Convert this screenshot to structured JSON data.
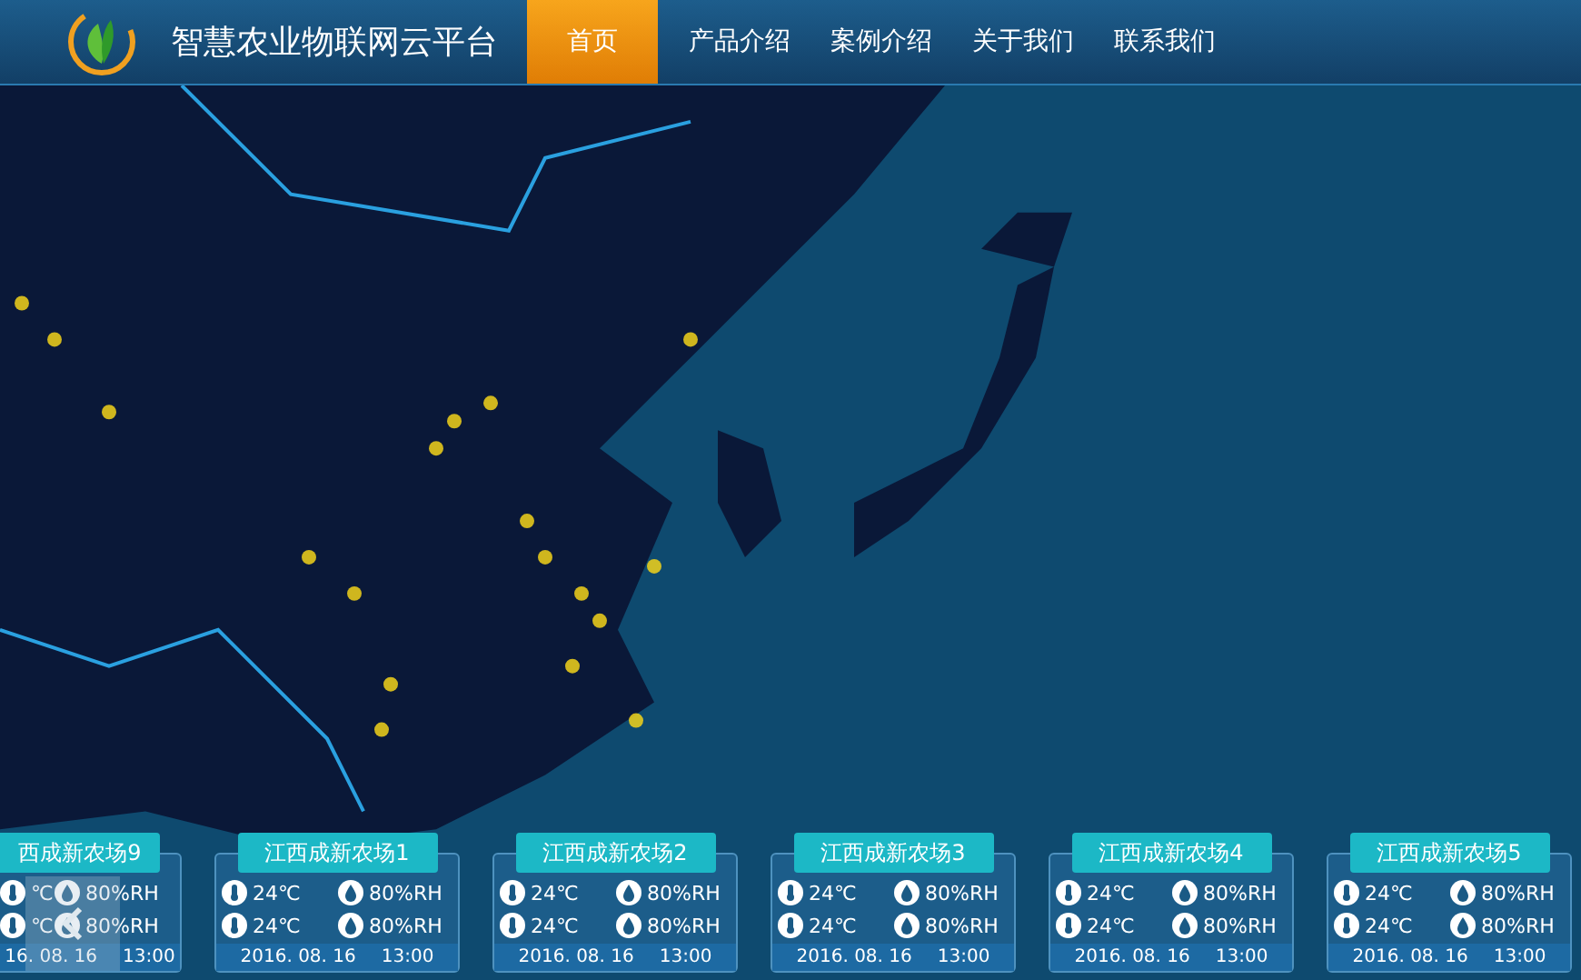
{
  "header": {
    "title": "智慧农业物联网云平台",
    "nav": [
      {
        "label": "首页",
        "selected": true
      },
      {
        "label": "产品介绍",
        "selected": false
      },
      {
        "label": "案例介绍",
        "selected": false
      },
      {
        "label": "关于我们",
        "selected": false
      },
      {
        "label": "联系我们",
        "selected": false
      }
    ]
  },
  "farms": [
    {
      "title": "西成新农场9",
      "cut": true,
      "readings": [
        {
          "kind": "temperature",
          "value": "℃"
        },
        {
          "kind": "humidity",
          "value": "80%RH"
        },
        {
          "kind": "temperature",
          "value": "℃"
        },
        {
          "kind": "humidity",
          "value": "80%RH"
        }
      ],
      "date": "16. 08. 16",
      "time": "13:00"
    },
    {
      "title": "江西成新农场1",
      "cut": false,
      "readings": [
        {
          "kind": "temperature",
          "value": "24℃"
        },
        {
          "kind": "humidity",
          "value": "80%RH"
        },
        {
          "kind": "temperature",
          "value": "24℃"
        },
        {
          "kind": "humidity",
          "value": "80%RH"
        }
      ],
      "date": "2016. 08. 16",
      "time": "13:00"
    },
    {
      "title": "江西成新农场2",
      "cut": false,
      "readings": [
        {
          "kind": "temperature",
          "value": "24℃"
        },
        {
          "kind": "humidity",
          "value": "80%RH"
        },
        {
          "kind": "temperature",
          "value": "24℃"
        },
        {
          "kind": "humidity",
          "value": "80%RH"
        }
      ],
      "date": "2016. 08. 16",
      "time": "13:00"
    },
    {
      "title": "江西成新农场3",
      "cut": false,
      "readings": [
        {
          "kind": "temperature",
          "value": "24℃"
        },
        {
          "kind": "humidity",
          "value": "80%RH"
        },
        {
          "kind": "temperature",
          "value": "24℃"
        },
        {
          "kind": "humidity",
          "value": "80%RH"
        }
      ],
      "date": "2016. 08. 16",
      "time": "13:00"
    },
    {
      "title": "江西成新农场4",
      "cut": false,
      "readings": [
        {
          "kind": "temperature",
          "value": "24℃"
        },
        {
          "kind": "humidity",
          "value": "80%RH"
        },
        {
          "kind": "temperature",
          "value": "24℃"
        },
        {
          "kind": "humidity",
          "value": "80%RH"
        }
      ],
      "date": "2016. 08. 16",
      "time": "13:00"
    },
    {
      "title": "江西成新农场5",
      "cut": false,
      "readings": [
        {
          "kind": "temperature",
          "value": "24℃"
        },
        {
          "kind": "humidity",
          "value": "80%RH"
        },
        {
          "kind": "temperature",
          "value": "24℃"
        },
        {
          "kind": "humidity",
          "value": "80%RH"
        }
      ],
      "date": "2016. 08. 16",
      "time": "13:00"
    }
  ]
}
